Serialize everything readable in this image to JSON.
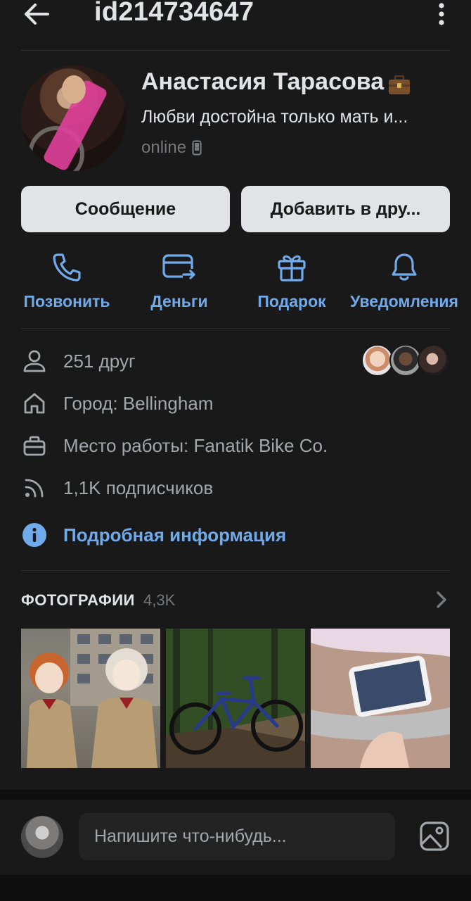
{
  "header": {
    "title": "id214734647"
  },
  "profile": {
    "name": "Анастасия Тарасова",
    "status": "Любви достойна только мать и...",
    "online": "online"
  },
  "buttons": {
    "message": "Сообщение",
    "add_friend": "Добавить в дру..."
  },
  "quick_actions": [
    {
      "label": "Позвонить",
      "icon": "phone-icon"
    },
    {
      "label": "Деньги",
      "icon": "money-transfer-icon"
    },
    {
      "label": "Подарок",
      "icon": "gift-icon"
    },
    {
      "label": "Уведомления",
      "icon": "bell-icon"
    }
  ],
  "info": {
    "friends": "251 друг",
    "city": "Город: Bellingham",
    "work": "Место работы: Fanatik Bike Co.",
    "followers": "1,1K подписчиков",
    "details_link": "Подробная информация"
  },
  "photos": {
    "title": "ФОТОГРАФИИ",
    "count": "4,3K"
  },
  "composer": {
    "placeholder": "Напишите что-нибудь..."
  },
  "colors": {
    "background": "#19191a",
    "accent": "#71aaeb",
    "button_bg": "#e1e3e6",
    "muted_text": "#a3a6ab"
  }
}
